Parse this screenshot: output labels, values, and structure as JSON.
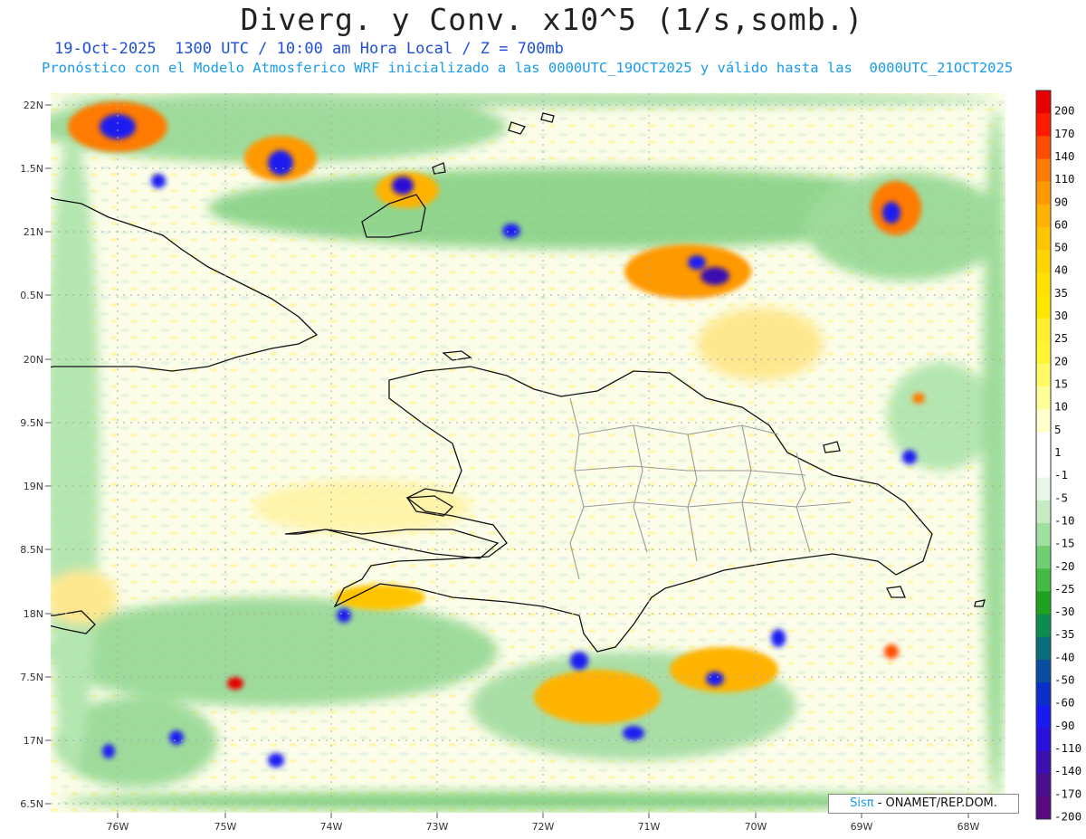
{
  "header": {
    "title": "Diverg. y Conv. x10^5 (1/s,somb.)",
    "subtitle_line1": "19-Oct-2025  1300 UTC / 10:00 am Hora Local / Z = 700mb",
    "subtitle_line2": "Pronóstico con el Modelo Atmosferico WRF inicializado a las 0000UTC_19OCT2025 y válido hasta las  0000UTC_21OCT2025"
  },
  "axes": {
    "lat_labels": [
      "22N",
      "1.5N",
      "21N",
      "0.5N",
      "20N",
      "9.5N",
      "19N",
      "8.5N",
      "18N",
      "7.5N",
      "17N",
      "6.5N"
    ],
    "lon_labels": [
      "76W",
      "75W",
      "74W",
      "73W",
      "72W",
      "71W",
      "70W",
      "69W",
      "68W"
    ]
  },
  "colorbar": {
    "labels": [
      "200",
      "170",
      "140",
      "110",
      "90",
      "60",
      "50",
      "40",
      "35",
      "30",
      "25",
      "20",
      "15",
      "10",
      "5",
      "1",
      "-1",
      "-5",
      "-10",
      "-15",
      "-20",
      "-25",
      "-30",
      "-35",
      "-40",
      "-50",
      "-60",
      "-90",
      "-110",
      "-140",
      "-170",
      "-200"
    ],
    "colors": [
      "#e60000",
      "#ff1a00",
      "#ff4d00",
      "#ff7a00",
      "#ff9900",
      "#ffb300",
      "#ffc400",
      "#ffd400",
      "#ffe100",
      "#ffe600",
      "#ffef2e",
      "#fff533",
      "#fffa66",
      "#ffff99",
      "#ffffcc",
      "#ffffff",
      "#ffffff",
      "#e8f6e8",
      "#c6ecc6",
      "#9fdf9f",
      "#70cf70",
      "#45bb45",
      "#1fa21f",
      "#0d8c4f",
      "#0a6e7a",
      "#0a4da0",
      "#0a2fc8",
      "#1a1af0",
      "#2a10d8",
      "#3a10b0",
      "#4a1090",
      "#5a0a80"
    ]
  },
  "credit": {
    "brand": "Sisπ",
    "text": "- ONAMET/REP.DOM."
  }
}
